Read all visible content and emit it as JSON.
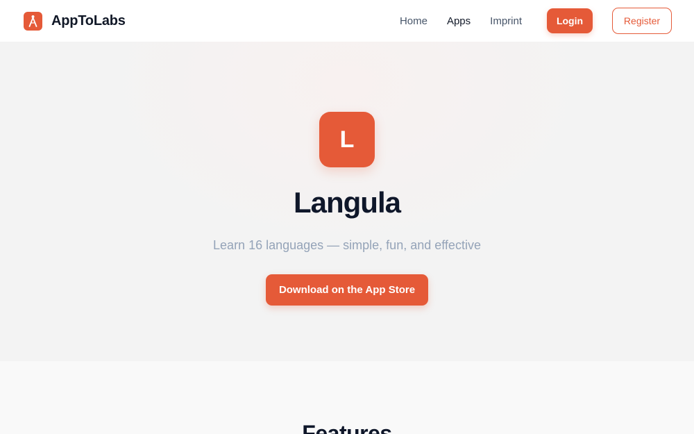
{
  "header": {
    "brand_name": "AppToLabs",
    "nav": [
      {
        "label": "Home"
      },
      {
        "label": "Apps"
      },
      {
        "label": "Imprint"
      }
    ],
    "login_label": "Login",
    "register_label": "Register"
  },
  "hero": {
    "icon_letter": "L",
    "title": "Langula",
    "subtitle": "Learn 16 languages — simple, fun, and effective",
    "download_label": "Download on the App Store"
  },
  "features": {
    "title": "Features"
  },
  "colors": {
    "accent": "#e55a38",
    "heading": "#0f172a",
    "muted": "#94a3b8"
  },
  "icons": {
    "brand_logo": "compass-icon"
  }
}
